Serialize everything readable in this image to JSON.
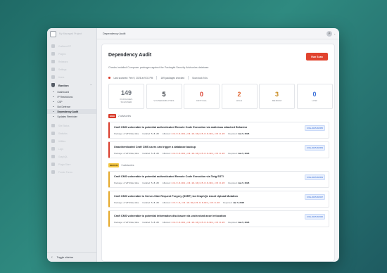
{
  "sidebar": {
    "project_label": "My Managed Project",
    "blurred_items": [
      "Craftcms/CP",
      "Plugins",
      "Releases",
      "Settings",
      "Users"
    ],
    "bastion_label": "Bastion",
    "sub_items": [
      "Dashboard",
      "IP Restrictions",
      "CSP",
      "Bot Defence",
      "Dependency Audit",
      "Updates Reminder"
    ],
    "active_item": "Dependency Audit",
    "blurred_items_2": [
      "Site Status",
      "Statistics",
      "Utilities",
      "Logs",
      "GraphQL",
      "Plugin Store",
      "Formie Forms"
    ],
    "toggle_label": "Toggle sidebar"
  },
  "header": {
    "breadcrumb": "Dependency Audit",
    "avatar_initial": "P"
  },
  "page": {
    "title": "Dependency Audit",
    "subtitle": "Checks installed Composer packages against the Packagist Security Advisories database.",
    "run_scan_label": "Run Scan",
    "last_scanned": "Last scanned: Feb 9, 2026 at 9:31 PM",
    "packages_checked": "169 packages checked",
    "scan_took": "Scan took 9.4s"
  },
  "stats": [
    {
      "value": "149",
      "label_line1": "PACKAGES",
      "label_line2": "SCANNED",
      "color": "#6b717a"
    },
    {
      "value": "5",
      "label_line1": "VULNERABILITIES",
      "label_line2": "",
      "color": "#22272e"
    },
    {
      "value": "0",
      "label_line1": "CRITICAL",
      "label_line2": "",
      "color": "#d93b2b"
    },
    {
      "value": "2",
      "label_line1": "HIGH",
      "label_line2": "",
      "color": "#e0632e"
    },
    {
      "value": "3",
      "label_line1": "MEDIUM",
      "label_line2": "",
      "color": "#c78a1e"
    },
    {
      "value": "0",
      "label_line1": "LOW",
      "label_line2": "",
      "color": "#3a6fd8"
    }
  ],
  "groups": {
    "high": {
      "badge": "HIGH",
      "count_label": "2 advisories",
      "color": "#d93b2b",
      "bg": "#d93b2b"
    },
    "medium": {
      "badge": "MEDIUM",
      "count_label": "3 advisories",
      "color": "#e5a82a",
      "bg": "#f3c643"
    }
  },
  "vulnerabilities": [
    {
      "title": "Craft CMS vulnerable to potential authenticated Remote Code Execution via malicious attached Behavior",
      "cve": "CVE-2025-68455",
      "package_label": "Package:",
      "package": "craftcms/cms",
      "installed_label": "Installed:",
      "installed": "5.8.20",
      "affected_label": "Affected:",
      "affected": ">=4.0.0-RC1,<=4.16.16|>=5.0.0-RC1,<=5.8.20",
      "reported_label": "Reported:",
      "reported": "Jan 5, 2026"
    },
    {
      "title": "Unauthenticated Craft CMS users can trigger a database backup",
      "cve": "CVE-2025-68453",
      "package_label": "Package:",
      "package": "craftcms/cms",
      "installed_label": "Installed:",
      "installed": "5.8.20",
      "affected_label": "Affected:",
      "affected": ">=4.0.0-RC1,<=4.16.16|>=5.0.0-RC1,<=5.8.20",
      "reported_label": "Reported:",
      "reported": "Jan 5, 2026"
    },
    {
      "title": "Craft CMS vulnerable to potential authenticated Remote Code Execution via Twig SSTI",
      "cve": "CVE-2025-68454",
      "package_label": "Package:",
      "package": "craftcms/cms",
      "installed_label": "Installed:",
      "installed": "5.8.20",
      "affected_label": "Affected:",
      "affected": ">=4.0.0-RC1,<=4.16.16|>=5.0.0-RC1,<=5.8.20",
      "reported_label": "Reported:",
      "reported": "Jan 5, 2026"
    },
    {
      "title": "Craft CMS vulnerable to Server-Side Request Forgery (SSRF) via GraphQL Asset Upload Mutation",
      "cve": "CVE-2025-68437",
      "package_label": "Package:",
      "package": "craftcms/cms",
      "installed_label": "Installed:",
      "installed": "5.8.20",
      "affected_label": "Affected:",
      "affected": ">=3.5.0,<=4.16.16|>=5.0.0-RC1,<=5.8.20",
      "reported_label": "Reported:",
      "reported": "Jan 5, 2026"
    },
    {
      "title": "Craft CMS vulnerable to potential information disclosure via unchecked asset relocation",
      "cve": "CVE-2025-68436",
      "package_label": "Package:",
      "package": "craftcms/cms",
      "installed_label": "Installed:",
      "installed": "5.8.20",
      "affected_label": "Affected:",
      "affected": ">=4.0.0-RC1,<=4.16.16|>=5.0.0-RC1,<=5.8.20",
      "reported_label": "Reported:",
      "reported": "Jan 5, 2026"
    }
  ]
}
